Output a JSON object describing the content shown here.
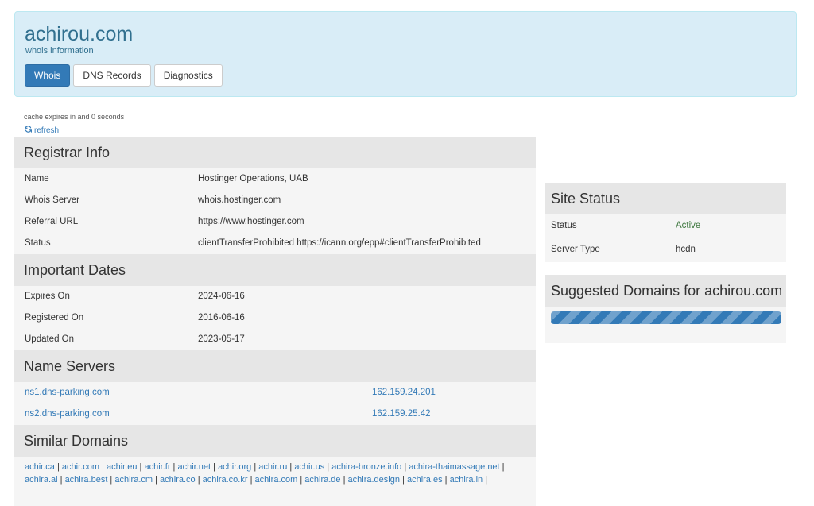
{
  "header": {
    "title": "achirou.com",
    "subtitle": "whois information",
    "tabs": [
      {
        "label": "Whois",
        "active": true
      },
      {
        "label": "DNS Records",
        "active": false
      },
      {
        "label": "Diagnostics",
        "active": false
      }
    ]
  },
  "cache": {
    "text": "cache expires in and 0 seconds",
    "refresh_label": "refresh"
  },
  "registrar": {
    "heading": "Registrar Info",
    "rows": [
      {
        "key": "Name",
        "value": "Hostinger Operations, UAB"
      },
      {
        "key": "Whois Server",
        "value": "whois.hostinger.com"
      },
      {
        "key": "Referral URL",
        "value": "https://www.hostinger.com"
      },
      {
        "key": "Status",
        "value": "clientTransferProhibited https://icann.org/epp#clientTransferProhibited"
      }
    ]
  },
  "dates": {
    "heading": "Important Dates",
    "rows": [
      {
        "key": "Expires On",
        "value": "2024-06-16"
      },
      {
        "key": "Registered On",
        "value": "2016-06-16"
      },
      {
        "key": "Updated On",
        "value": "2023-05-17"
      }
    ]
  },
  "nameservers": {
    "heading": "Name Servers",
    "rows": [
      {
        "host": "ns1.dns-parking.com",
        "ip": "162.159.24.201"
      },
      {
        "host": "ns2.dns-parking.com",
        "ip": "162.159.25.42"
      }
    ]
  },
  "similar": {
    "heading": "Similar Domains",
    "domains": [
      "achir.ca",
      "achir.com",
      "achir.eu",
      "achir.fr",
      "achir.net",
      "achir.org",
      "achir.ru",
      "achir.us",
      "achira-bronze.info",
      "achira-thaimassage.net",
      "achira.ai",
      "achira.best",
      "achira.cm",
      "achira.co",
      "achira.co.kr",
      "achira.com",
      "achira.de",
      "achira.design",
      "achira.es",
      "achira.in"
    ]
  },
  "site_status": {
    "heading": "Site Status",
    "status_label": "Status",
    "status_value": "Active",
    "server_label": "Server Type",
    "server_value": "hcdn"
  },
  "suggested": {
    "heading": "Suggested Domains for achirou.com"
  },
  "colors": {
    "accent": "#337ab7",
    "header_bg": "#d9edf7",
    "active_status": "#3c763d"
  }
}
